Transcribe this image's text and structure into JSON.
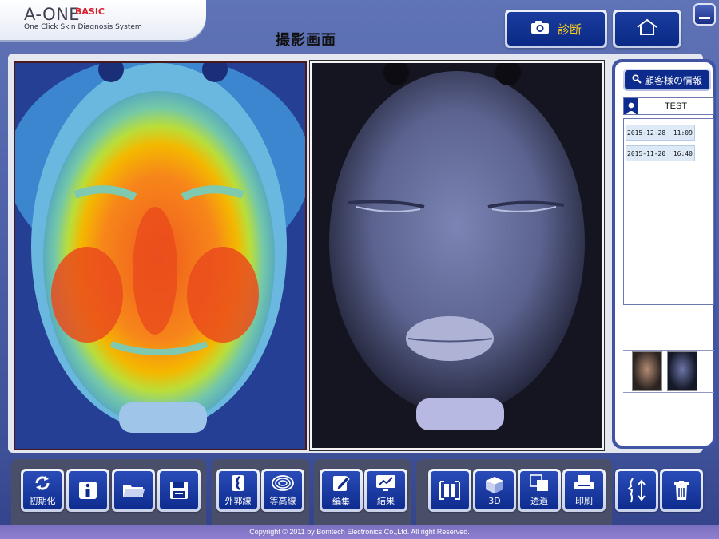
{
  "app": {
    "logo_title": "A-ONE",
    "logo_edition": "BASIC",
    "logo_tagline": "One Click Skin Diagnosis System"
  },
  "header": {
    "screen_title": "撮影画面",
    "diagnosis_label": "診断"
  },
  "sidebar": {
    "customer_info_label": "顧客様の情報",
    "customer_name": "TEST",
    "sessions": [
      {
        "date": "2015-12-28",
        "time": "11:09"
      },
      {
        "date": "2015-11-20",
        "time": "16:40"
      }
    ]
  },
  "toolbar": {
    "reset_label": "初期化",
    "outline_label": "外郭線",
    "contour_label": "等高線",
    "edit_label": "編集",
    "result_label": "結果",
    "view_3d_label": "3D",
    "transparency_label": "透過",
    "print_label": "印刷"
  },
  "footer": {
    "copyright": "Copyright © 2011 by Bomtech Electronics Co.,Ltd. All right Reserved."
  },
  "colors": {
    "button_blue": "#0e2c8f",
    "accent_yellow": "#ffd21e",
    "logo_red": "#d6202c"
  }
}
